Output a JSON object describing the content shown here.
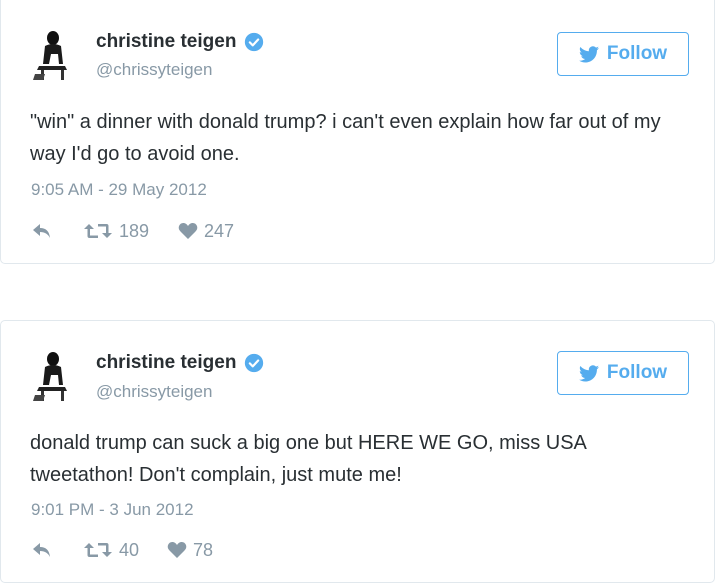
{
  "tweets": [
    {
      "display_name": "christine teigen",
      "screen_name": "@chrissyteigen",
      "follow_label": "Follow",
      "text": "\"win\" a dinner with donald trump? i can't even explain how far out of my way I'd go to avoid one.",
      "timestamp": "9:05 AM - 29 May 2012",
      "retweets": "189",
      "likes": "247"
    },
    {
      "display_name": "christine teigen",
      "screen_name": "@chrissyteigen",
      "follow_label": "Follow",
      "text": "donald trump can suck a big one but HERE WE GO, miss USA tweetathon! Don't complain, just mute me!",
      "timestamp": "9:01 PM - 3 Jun 2012",
      "retweets": "40",
      "likes": "78"
    }
  ],
  "icons": {
    "verified": "verified-badge-icon",
    "follow": "twitter-bird-icon",
    "reply": "reply-arrow-icon",
    "retweet": "retweet-icon",
    "like": "heart-icon"
  },
  "colors": {
    "brand_blue": "#55acee",
    "text_primary": "#292f33",
    "text_secondary": "#8899a6",
    "card_border": "#e1e8ed"
  }
}
